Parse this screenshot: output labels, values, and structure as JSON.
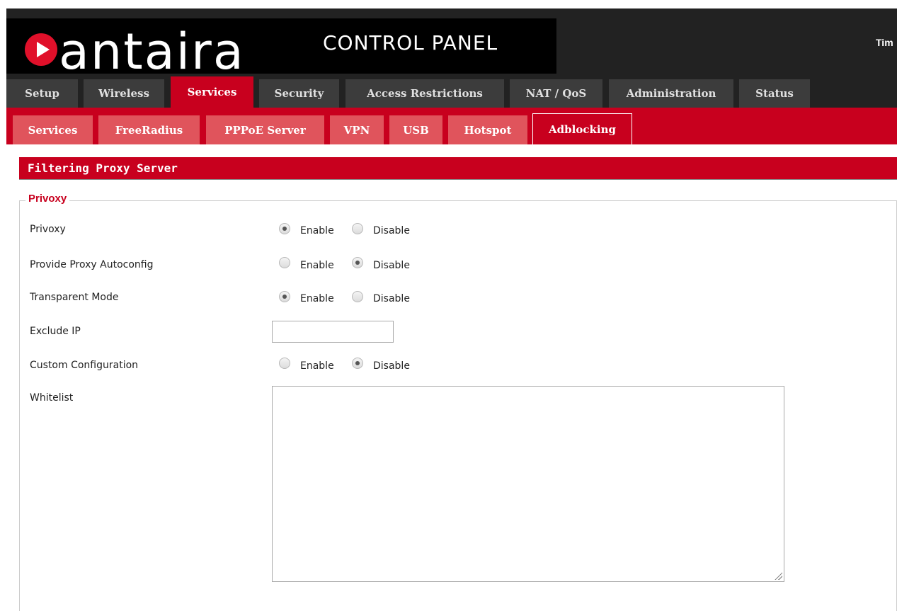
{
  "brand": {
    "logo_text": "antaira",
    "panel_title": "CONTROL PANEL",
    "corner_text": "Tim",
    "accent_color": "#c8001e"
  },
  "main_nav": {
    "tabs": [
      {
        "label": "Setup",
        "active": false
      },
      {
        "label": "Wireless",
        "active": false
      },
      {
        "label": "Services",
        "active": true
      },
      {
        "label": "Security",
        "active": false
      },
      {
        "label": "Access Restrictions",
        "active": false
      },
      {
        "label": "NAT / QoS",
        "active": false
      },
      {
        "label": "Administration",
        "active": false
      },
      {
        "label": "Status",
        "active": false
      }
    ]
  },
  "sub_nav": {
    "tabs": [
      {
        "label": "Services",
        "active": false
      },
      {
        "label": "FreeRadius",
        "active": false
      },
      {
        "label": "PPPoE Server",
        "active": false
      },
      {
        "label": "VPN",
        "active": false
      },
      {
        "label": "USB",
        "active": false
      },
      {
        "label": "Hotspot",
        "active": false
      },
      {
        "label": "Adblocking",
        "active": true
      }
    ]
  },
  "section": {
    "title": "Filtering Proxy Server",
    "fieldset_legend": "Privoxy"
  },
  "form": {
    "enable_label": "Enable",
    "disable_label": "Disable",
    "rows": [
      {
        "label": "Privoxy",
        "value": "Enable"
      },
      {
        "label": "Provide Proxy Autoconfig",
        "value": "Disable"
      },
      {
        "label": "Transparent Mode",
        "value": "Enable"
      },
      {
        "label": "Custom Configuration",
        "value": "Disable"
      }
    ],
    "exclude_ip": {
      "label": "Exclude IP",
      "value": ""
    },
    "whitelist": {
      "label": "Whitelist",
      "value": ""
    }
  }
}
